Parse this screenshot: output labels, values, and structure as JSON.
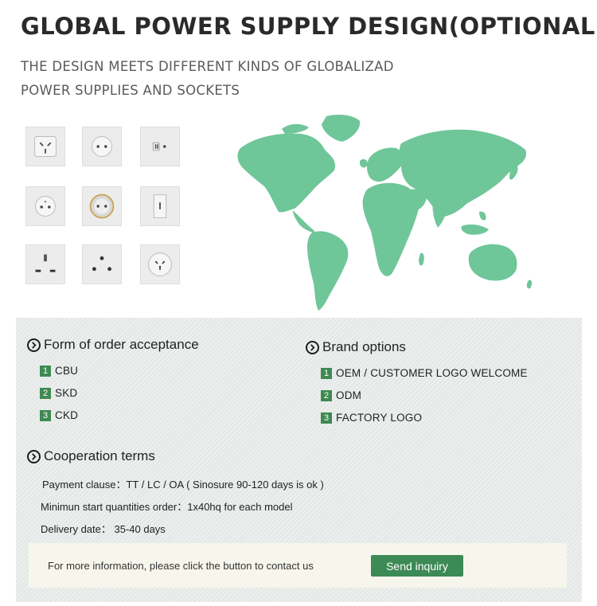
{
  "header": {
    "title": "GLOBAL POWER SUPPLY DESIGN(OPTIONAL)",
    "subtitle_line1": "THE DESIGN MEETS DIFFERENT KINDS OF GLOBALIZAD",
    "subtitle_line2": "POWER SUPPLIES AND SOCKETS"
  },
  "sockets": [
    "au-socket-icon",
    "eu-round-socket-icon",
    "two-pin-flat-socket-icon",
    "french-socket-icon",
    "schuko-socket-icon",
    "vertical-slot-socket-icon",
    "uk-socket-icon",
    "round-three-pin-socket-icon",
    "china-socket-icon"
  ],
  "map": {
    "color": "#5cbf8c"
  },
  "order": {
    "heading": "Form of order acceptance",
    "items": [
      {
        "num": "1",
        "label": "CBU"
      },
      {
        "num": "2",
        "label": "SKD"
      },
      {
        "num": "3",
        "label": "CKD"
      }
    ]
  },
  "brand": {
    "heading": "Brand options",
    "items": [
      {
        "num": "1",
        "label": "OEM / CUSTOMER LOGO  WELCOME"
      },
      {
        "num": "2",
        "label": "ODM"
      },
      {
        "num": "3",
        "label": "FACTORY LOGO"
      }
    ]
  },
  "cooperation": {
    "heading": "Cooperation terms",
    "payment": "Payment clause：TT  /  LC  /  OA ( Sinosure  90-120 days is ok )",
    "moq": "Minimun start quantities order：1x40hq for each model",
    "delivery": "Delivery date：  35-40 days"
  },
  "contact": {
    "text": "For more information, please click the button to contact us",
    "button_label": "Send inquiry",
    "button_color": "#3c8a55"
  },
  "colors": {
    "accent": "#3f8a52",
    "panel": "#e4e8e6"
  }
}
